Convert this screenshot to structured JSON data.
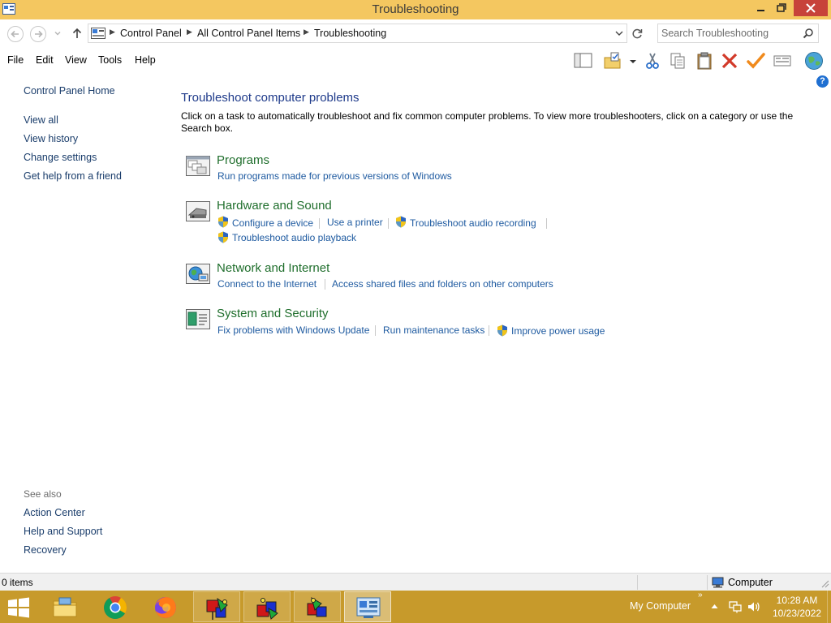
{
  "window": {
    "title": "Troubleshooting",
    "colors": {
      "titlebar": "#f4c760",
      "close": "#c7423a",
      "taskbar": "#c79a2b",
      "link": "#1e5aa0",
      "category": "#1f6e2c",
      "heading": "#1e3a8a"
    }
  },
  "address": {
    "crumbs": [
      "Control Panel",
      "All Control Panel Items",
      "Troubleshooting"
    ],
    "search_placeholder": "Search Troubleshooting"
  },
  "menu": [
    "File",
    "Edit",
    "View",
    "Tools",
    "Help"
  ],
  "toolbar_icons": [
    "preview-pane-icon",
    "folder-options-icon",
    "cut-icon",
    "copy-icon",
    "paste-icon",
    "delete-icon",
    "checkmark-icon",
    "properties-icon",
    "globe-icon"
  ],
  "sidebar": {
    "home": "Control Panel Home",
    "links": [
      "View all",
      "View history",
      "Change settings",
      "Get help from a friend"
    ],
    "see_also_label": "See also",
    "see_also": [
      "Action Center",
      "Help and Support",
      "Recovery"
    ]
  },
  "main": {
    "help": "?",
    "title": "Troubleshoot computer problems",
    "description": "Click on a task to automatically troubleshoot and fix common computer problems. To view more troubleshooters, click on a category or use the Search box.",
    "categories": [
      {
        "title": "Programs",
        "tasks": [
          "Run programs made for previous versions of Windows"
        ]
      },
      {
        "title": "Hardware and Sound",
        "tasks": [
          "Configure a device",
          "Use a printer",
          "Troubleshoot audio recording",
          "Troubleshoot audio playback"
        ]
      },
      {
        "title": "Network and Internet",
        "tasks": [
          "Connect to the Internet",
          "Access shared files and folders on other computers"
        ]
      },
      {
        "title": "System and Security",
        "tasks": [
          "Fix problems with Windows Update",
          "Run maintenance tasks",
          "Improve power usage"
        ]
      }
    ]
  },
  "status": {
    "items": "0 items",
    "zone": "Computer"
  },
  "taskbar": {
    "apps": [
      "file-explorer-icon",
      "chrome-icon",
      "firefox-icon",
      "cube-app-icon",
      "cube-app-icon",
      "cube-app-icon",
      "control-panel-icon"
    ],
    "tray_label": "My Computer",
    "tray_chevron": "»",
    "time": "10:28 AM",
    "date": "10/23/2022"
  }
}
